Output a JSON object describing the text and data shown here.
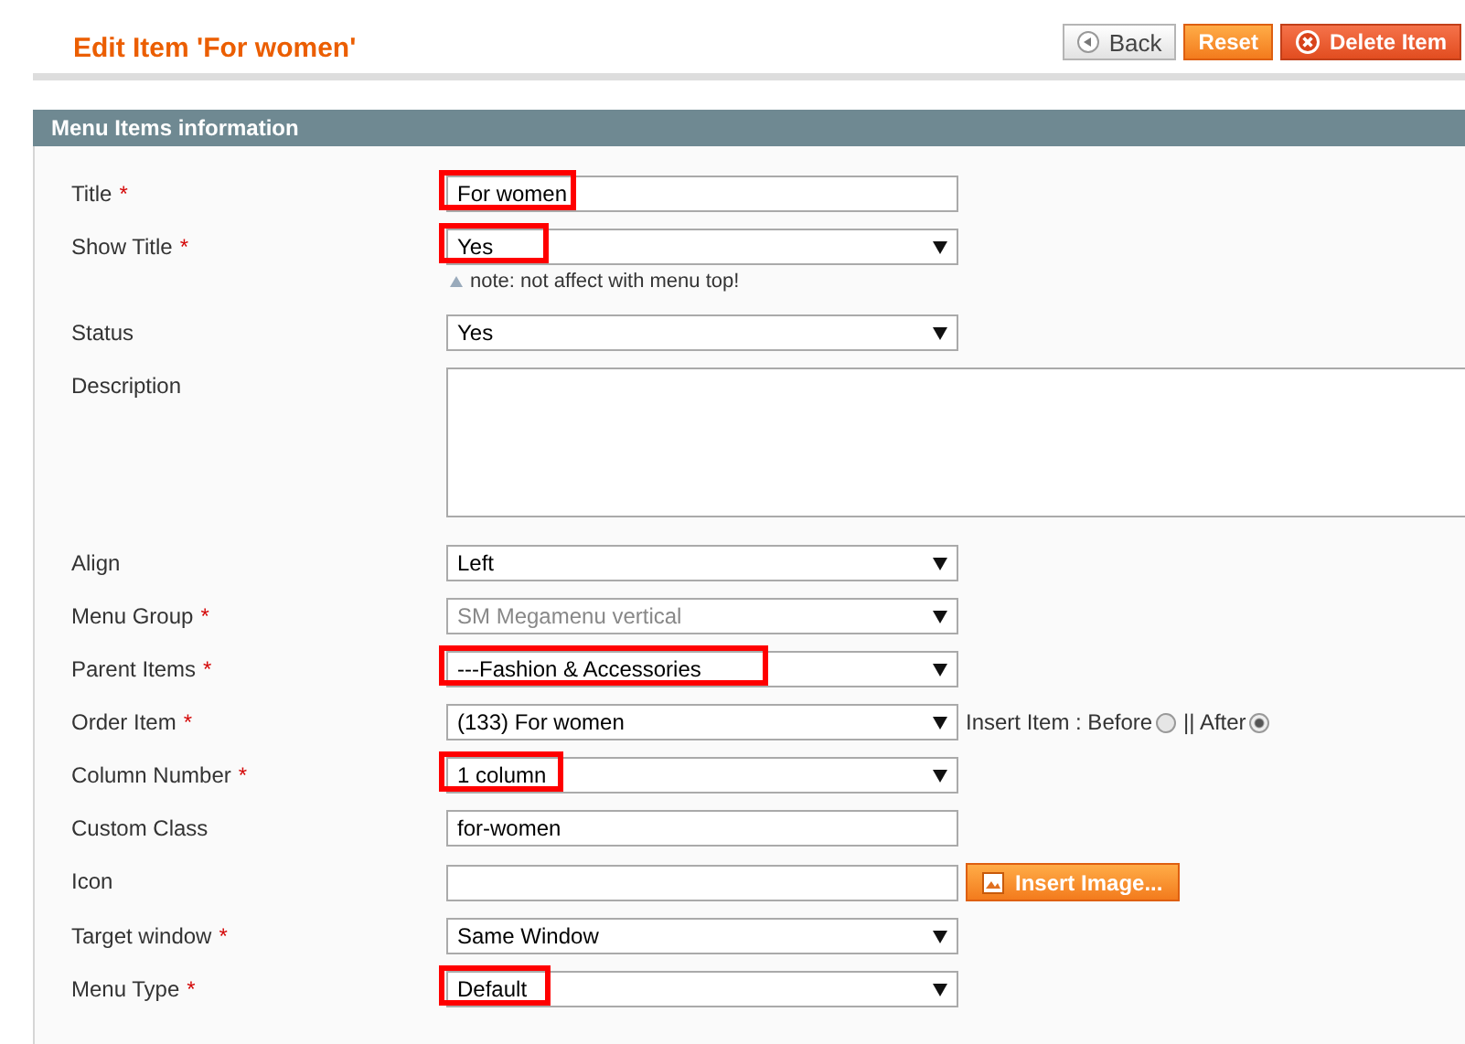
{
  "page_title": "Edit Item 'For women'",
  "buttons": [
    {
      "label": "Back",
      "kind": "back"
    },
    {
      "label": "Reset",
      "kind": "reset"
    },
    {
      "label": "Delete Item",
      "kind": "delete"
    }
  ],
  "section_title": "Menu Items information",
  "fields": [
    {
      "label": "Title",
      "required_mark": "*",
      "kind": "text",
      "value": "For women",
      "highlighted": true
    },
    {
      "label": "Show Title",
      "required_mark": "*",
      "kind": "select",
      "value": "Yes",
      "highlighted": true,
      "note": "note: not affect with menu top!"
    },
    {
      "label": "Status",
      "kind": "select",
      "value": "Yes",
      "highlighted": false
    },
    {
      "label": "Description",
      "kind": "textarea",
      "highlighted": false
    },
    {
      "label": "Align",
      "kind": "select",
      "value": "Left",
      "highlighted": false
    },
    {
      "label": "Menu Group",
      "required_mark": "*",
      "kind": "select",
      "value": "SM Megamenu vertical",
      "highlighted": false,
      "disabled": true
    },
    {
      "label": "Parent Items",
      "required_mark": "*",
      "kind": "select",
      "value": "---Fashion & Accessories",
      "highlighted": true
    },
    {
      "label": "Order Item",
      "required_mark": "*",
      "kind": "select",
      "value": "(133) For women",
      "highlighted": false,
      "radios": [
        {
          "label": "Insert Item : Before",
          "selected": false
        },
        {
          "label": "|| After",
          "selected": true
        }
      ]
    },
    {
      "label": "Column Number",
      "required_mark": "*",
      "kind": "select",
      "value": "1 column",
      "highlighted": true
    },
    {
      "label": "Custom Class",
      "kind": "text",
      "value": "for-women",
      "highlighted": false
    },
    {
      "label": "Icon",
      "kind": "text",
      "highlighted": false,
      "button": "Insert Image..."
    },
    {
      "label": "Target window",
      "required_mark": "*",
      "kind": "select",
      "value": "Same Window",
      "highlighted": false
    },
    {
      "label": "Menu Type",
      "required_mark": "*",
      "kind": "select",
      "value": "Default",
      "highlighted": true
    }
  ]
}
